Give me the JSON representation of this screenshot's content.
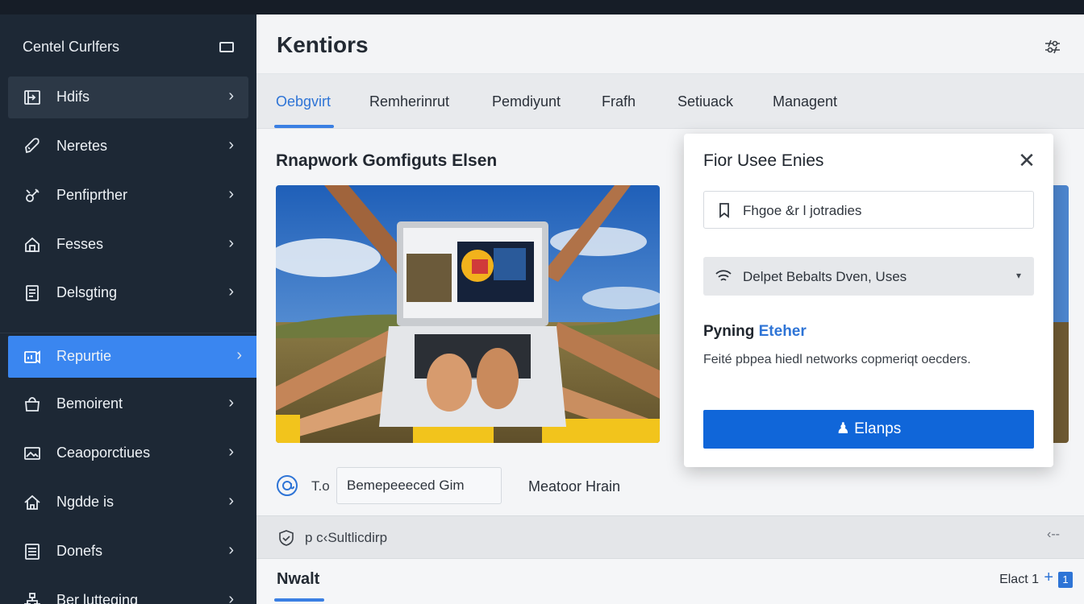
{
  "sidebar": {
    "title": "Centel Curlfers",
    "collapse_icon": "panel-icon",
    "items": [
      {
        "label": "Hdifs",
        "icon": "dashboard-icon",
        "state": "hover"
      },
      {
        "label": "Neretes",
        "icon": "rocket-icon",
        "state": "normal"
      },
      {
        "label": "Penfiprther",
        "icon": "tools-icon",
        "state": "normal"
      },
      {
        "label": "Fesses",
        "icon": "home-icon",
        "state": "normal"
      },
      {
        "label": "Delsgting",
        "icon": "document-icon",
        "state": "normal"
      },
      {
        "label": "Repurtie",
        "icon": "report-icon",
        "state": "active"
      },
      {
        "label": "Bemoirent",
        "icon": "bag-icon",
        "state": "normal"
      },
      {
        "label": "Ceaoporctiues",
        "icon": "image-icon",
        "state": "normal"
      },
      {
        "label": "Ngdde is",
        "icon": "house-icon",
        "state": "normal"
      },
      {
        "label": "Donefs",
        "icon": "list-icon",
        "state": "normal"
      },
      {
        "label": "Ber lutteging",
        "icon": "network-icon",
        "state": "normal"
      }
    ]
  },
  "header": {
    "title": "Kentiors",
    "settings_icon": "sliders-icon"
  },
  "tabs": [
    {
      "label": "Oebgvirt",
      "active": true
    },
    {
      "label": "Remherinrut",
      "active": false
    },
    {
      "label": "Pemdiyunt",
      "active": false
    },
    {
      "label": "Frafh",
      "active": false
    },
    {
      "label": "Setiuack",
      "active": false
    },
    {
      "label": "Managent",
      "active": false
    }
  ],
  "content": {
    "section_title": "Rnapwork Gomfiguts Elsen",
    "hero_image": "people-with-laptop-photo",
    "to_label": "T.o",
    "input_value": "Bemepeeeced Gim",
    "mention_label": "Meatoor Hrain"
  },
  "strip": {
    "text": "p c‹Sultlicdirp",
    "end": "‹--"
  },
  "footer": {
    "title": "Nwalt",
    "right_text": "Elact 1",
    "plus": "+",
    "box_label": "1"
  },
  "dialog": {
    "title": "Fior Usee Enies",
    "close_glyph": "✕",
    "input_text": "Fhgoe &r l jotradies",
    "select_text": "Delpet Bebalts Dven, Uses",
    "select_caret": "▾",
    "heading_plain": "Pyning ",
    "heading_link": "Eteher",
    "description": "Feité pbpea hiedl networks copmeriqt oecders.",
    "button_label": "Elanps",
    "button_icon": "user-icon"
  },
  "colors": {
    "sidebar_bg": "#1d2835",
    "active_item": "#3a86f0",
    "accent": "#2e74d6",
    "primary_button": "#1066d9"
  }
}
